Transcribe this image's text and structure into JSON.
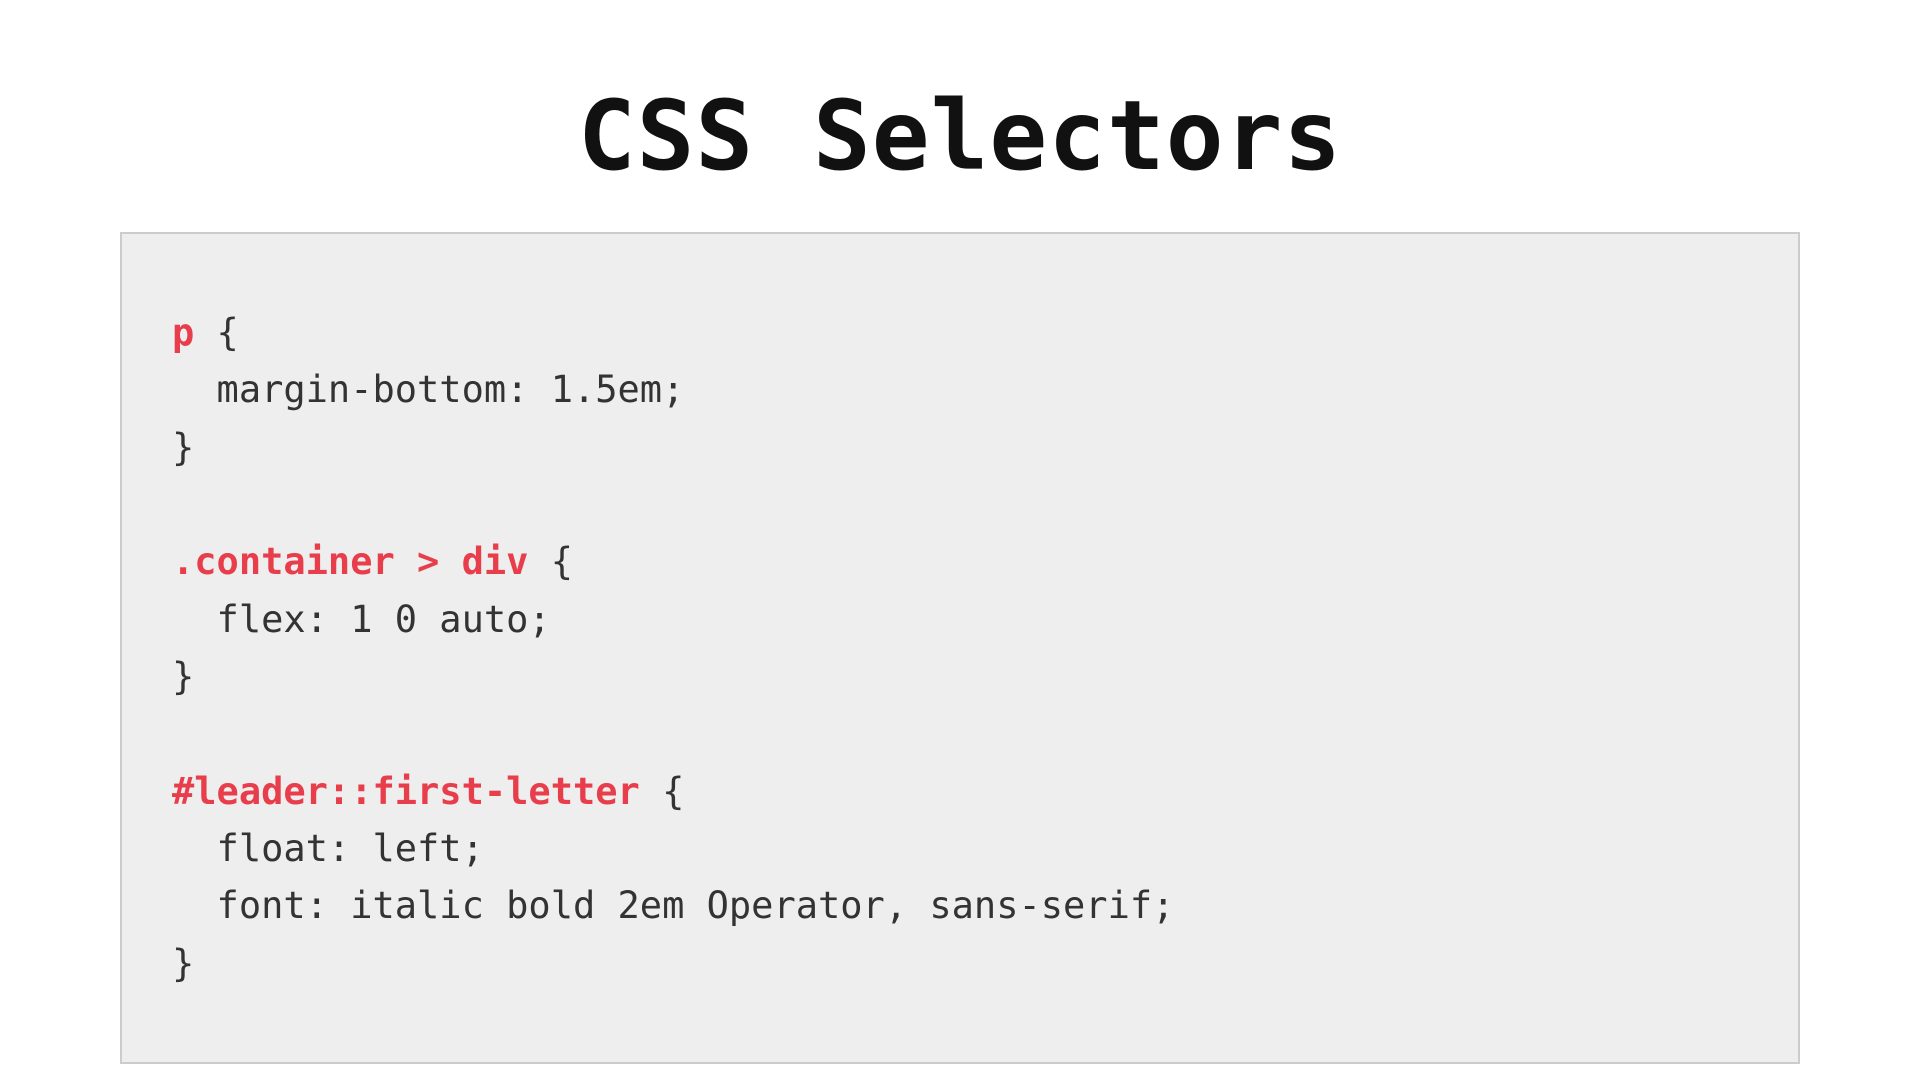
{
  "title": "CSS Selectors",
  "colors": {
    "selector": "#e83e4c",
    "code_bg": "#eeeeee",
    "code_border": "#cccccc",
    "text": "#333333"
  },
  "code": {
    "rules": [
      {
        "selector": "p",
        "open": " {",
        "declarations": [
          "  margin-bottom: 1.5em;"
        ],
        "close": "}"
      },
      {
        "selector": ".container > div",
        "open": " {",
        "declarations": [
          "  flex: 1 0 auto;"
        ],
        "close": "}"
      },
      {
        "selector": "#leader::first-letter",
        "open": " {",
        "declarations": [
          "  float: left;",
          "  font: italic bold 2em Operator, sans-serif;"
        ],
        "close": "}"
      }
    ]
  }
}
